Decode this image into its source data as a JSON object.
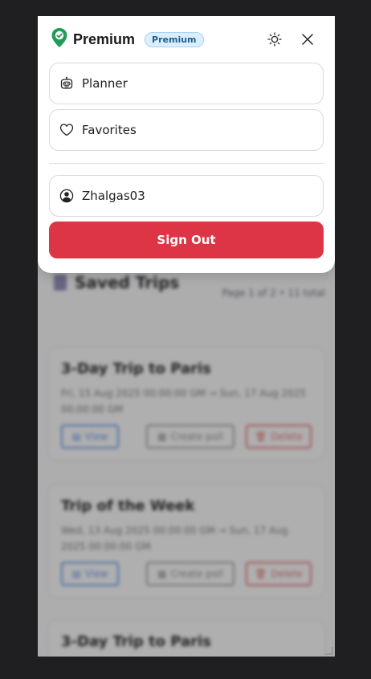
{
  "app": {
    "brand": "Premium",
    "badge": "Premium"
  },
  "menu": {
    "planner_label": "Planner",
    "favorites_label": "Favorites",
    "user_label": "Zhalgas03",
    "signout_label": "Sign Out"
  },
  "background": {
    "title": "Saved Trips",
    "meta": "Page 1 of 2 • 11 total",
    "trips": [
      {
        "title": "3-Day Trip to Paris",
        "date_line1": "Fri, 15 Aug 2025 00:00:00 GM → Sun, 17 Aug 2025",
        "date_line2": "00:00:00 GM",
        "view": "View",
        "poll": "Create poll",
        "delete": "Delete"
      },
      {
        "title": "Trip of the Week",
        "date_line1": "Wed, 13 Aug 2025 00:00:00 GM → Sun, 17 Aug",
        "date_line2": "2025 00:00:00 GM",
        "view": "View",
        "poll": "Create poll",
        "delete": "Delete"
      },
      {
        "title": "3-Day Trip to Paris"
      }
    ]
  },
  "colors": {
    "signout": "#dd3545",
    "badge_bg": "#dbeefe",
    "brand_pin": "#1f9d57"
  },
  "icons": [
    "map-pin-icon",
    "sun-icon",
    "close-icon",
    "robot-icon",
    "heart-icon",
    "user-circle-icon"
  ]
}
